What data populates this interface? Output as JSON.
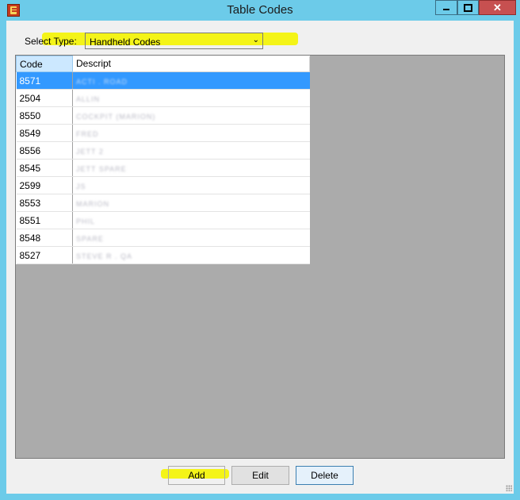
{
  "window": {
    "title": "Table Codes",
    "icon": "app-icon",
    "controls": [
      "minimize-icon",
      "maximize-icon",
      "close-icon"
    ],
    "accent": "#6ccbe9"
  },
  "filter": {
    "label": "Select Type:",
    "selected": "Handheld Codes"
  },
  "grid": {
    "columns": [
      "Code",
      "Descript"
    ],
    "rows": [
      {
        "code": "8571",
        "desc": "ACTI . ROAD",
        "selected": true
      },
      {
        "code": "2504",
        "desc": "ALLIN"
      },
      {
        "code": "8550",
        "desc": "COCKPIT (MARION)"
      },
      {
        "code": "8549",
        "desc": "FRED"
      },
      {
        "code": "8556",
        "desc": "JETT 2"
      },
      {
        "code": "8545",
        "desc": "JETT SPARE"
      },
      {
        "code": "2599",
        "desc": "JS"
      },
      {
        "code": "8553",
        "desc": "MARION"
      },
      {
        "code": "8551",
        "desc": "PHIL"
      },
      {
        "code": "8548",
        "desc": "SPARE"
      },
      {
        "code": "8527",
        "desc": "STEVE R . QA"
      }
    ],
    "selection_color": "#3399ff"
  },
  "buttons": {
    "add": "Add",
    "edit": "Edit",
    "delete": "Delete"
  },
  "highlight_color": "#f4f400"
}
